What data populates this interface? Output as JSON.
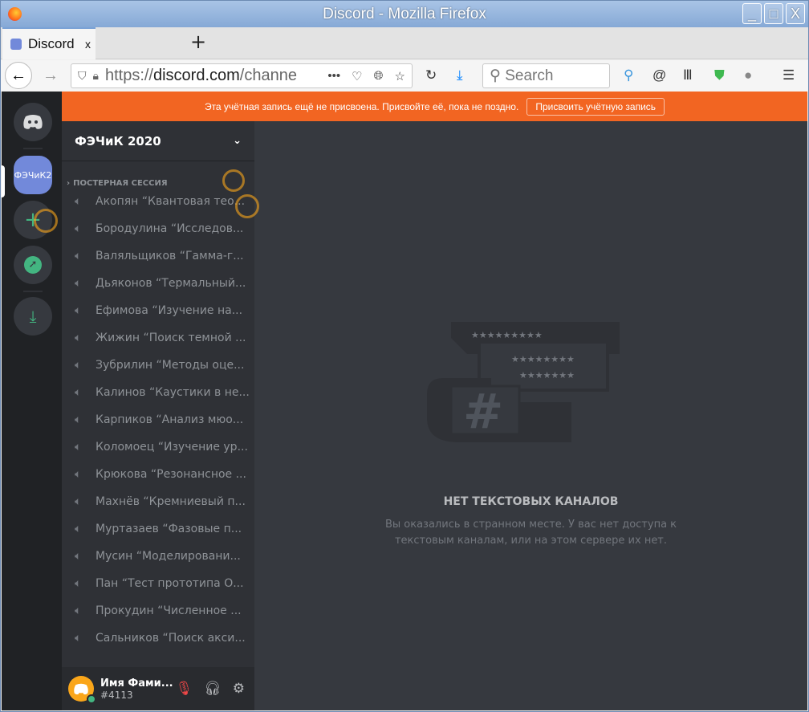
{
  "window": {
    "title": "Discord - Mozilla Firefox"
  },
  "tab": {
    "label": "Discord",
    "close": "x",
    "new_tab": "+"
  },
  "nav": {
    "url_scheme": "https://",
    "url_host": "discord.com",
    "url_rest": "/channe",
    "search_placeholder": "Search"
  },
  "banner": {
    "text": "Эта учётная запись ещё не присвоена. Присвойте её, пока не поздно.",
    "button": "Присвоить учётную запись",
    "color": "#f26522"
  },
  "rail": {
    "server_label": "ФЭЧиК2"
  },
  "server": {
    "name": "ФЭЧиК 2020",
    "category": "ПОСТЕРНАЯ СЕССИЯ",
    "channels": [
      "Акопян “Квантовая тео...",
      "Бородулина “Исследов...",
      "Валяльщиков “Гамма-г...",
      "Дьяконов “Термальный...",
      "Ефимова “Изучение на...",
      "Жижин “Поиск темной ...",
      "Зубрилин “Методы оце...",
      "Калинов “Каустики в не...",
      "Карпиков “Анализ мюо...",
      "Коломоец “Изучение ур...",
      "Крюкова “Резонансное ...",
      "Махнёв “Кремниевый п...",
      "Муртазаев “Фазовые п...",
      "Мусин “Моделировани...",
      "Пан “Тест прототипа О...",
      "Прокудин “Численное ...",
      "Сальников “Поиск акси..."
    ]
  },
  "user": {
    "name": "Имя Фами...",
    "tag": "#4113",
    "status_color": "#43b581"
  },
  "empty": {
    "title": "НЕТ ТЕКСТОВЫХ КАНАЛОВ",
    "description": "Вы оказались в странном месте. У вас нет доступа к текстовым каналам, или на этом сервере их нет.",
    "stars1": "★★★★★★★★★",
    "stars2": "★★★★★★★★",
    "stars3": "★★★★★★★"
  }
}
